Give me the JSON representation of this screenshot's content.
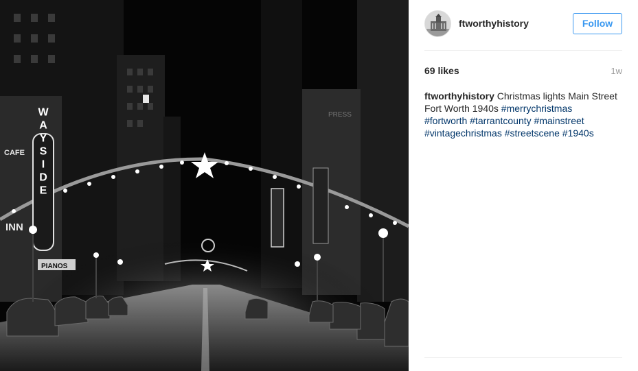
{
  "post": {
    "image_alt": "Christmas lights Main Street Fort Worth 1940s",
    "author": {
      "username": "ftworthyhistory",
      "avatar_icon": "courthouse-avatar-icon"
    },
    "follow_label": "Follow",
    "likes_text": "69 likes",
    "time_ago": "1w",
    "caption": {
      "username": "ftworthyhistory",
      "text": "Christmas lights Main Street Fort Worth 1940s",
      "hashtags": [
        "#merrychristmas",
        "#fortworth",
        "#tarrantcounty",
        "#mainstreet",
        "#vintagechristmas",
        "#streetscene",
        "#1940s"
      ]
    }
  },
  "photo_signs": {
    "theater": "WAYSIDE",
    "cafe": "CAFE",
    "inn": "INN",
    "pianos": "PIANOS",
    "press": "PRESS"
  },
  "colors": {
    "accent": "#3897f0",
    "hashtag": "#003569",
    "muted": "#999999",
    "divider": "#efefef"
  }
}
